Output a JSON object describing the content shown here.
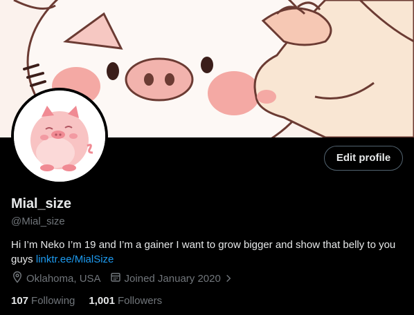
{
  "profile": {
    "display_name": "Mial_size",
    "handle": "@Mial_size",
    "bio_text": "Hi I’m Neko I’m 19 and I’m a gainer I want to grow bigger and show that belly to you guys",
    "bio_link": "linktr.ee/MialSize",
    "location": "Oklahoma, USA",
    "joined": "Joined January 2020",
    "following_count": "107",
    "following_label": "Following",
    "followers_count": "1,001",
    "followers_label": "Followers"
  },
  "actions": {
    "edit_profile_label": "Edit profile"
  },
  "icons": {
    "location": "location-pin-icon",
    "calendar": "calendar-icon",
    "chevron": "chevron-right-icon"
  },
  "colors": {
    "accent": "#1d9bf0",
    "secondary_text": "#71767b",
    "primary_text": "#e7e9ea",
    "background": "#000000"
  }
}
